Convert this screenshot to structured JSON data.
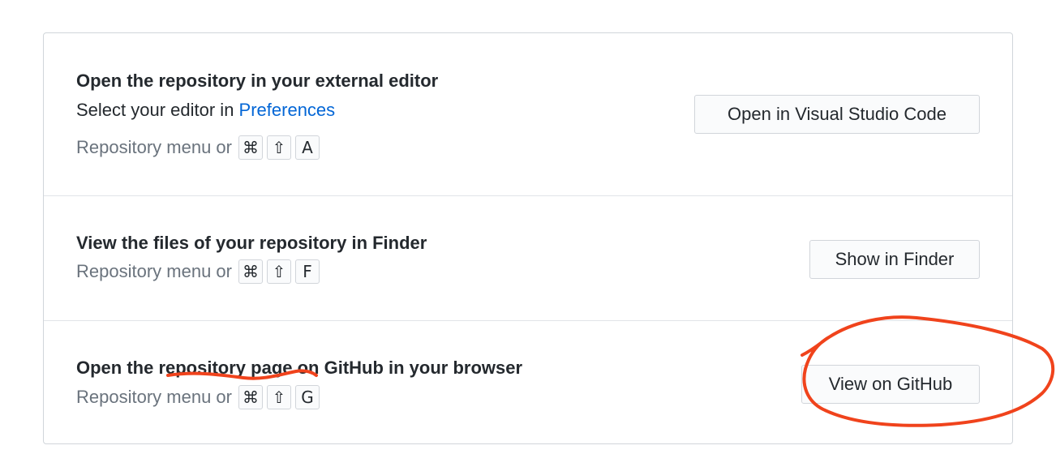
{
  "rows": [
    {
      "title": "Open the repository in your external editor",
      "subtitle_prefix": "Select your editor in ",
      "subtitle_link": "Preferences",
      "shortcut_prefix": "Repository menu or",
      "keys": [
        "⌘",
        "⇧",
        "A"
      ],
      "button_label": "Open in Visual Studio Code"
    },
    {
      "title": "View the files of your repository in Finder",
      "shortcut_prefix": "Repository menu or",
      "keys": [
        "⌘",
        "⇧",
        "F"
      ],
      "button_label": "Show in Finder"
    },
    {
      "title": "Open the repository page on GitHub in your browser",
      "shortcut_prefix": "Repository menu or",
      "keys": [
        "⌘",
        "⇧",
        "G"
      ],
      "button_label": "View on GitHub"
    }
  ],
  "colors": {
    "link": "#0366d6",
    "annotation": "#f0431c"
  }
}
